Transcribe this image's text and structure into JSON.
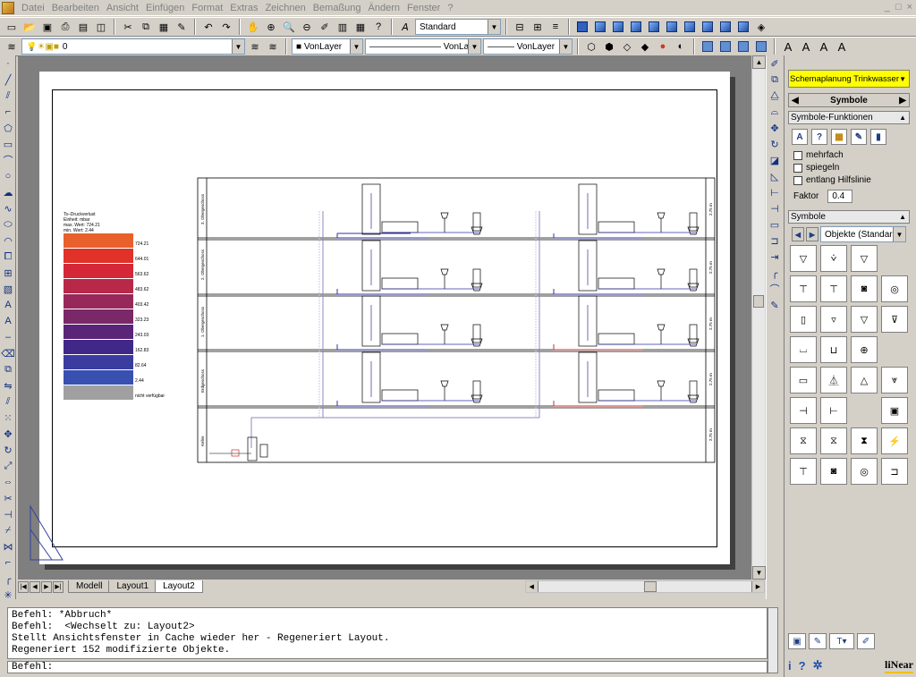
{
  "menu": [
    "Datei",
    "Bearbeiten",
    "Ansicht",
    "Einfügen",
    "Format",
    "Extras",
    "Zeichnen",
    "Bemaßung",
    "Ändern",
    "Fenster",
    "?"
  ],
  "window_controls": [
    "_",
    "□",
    "×"
  ],
  "toolbar1": {
    "text_style": "Standard"
  },
  "toolbar2": {
    "layer": "0",
    "color": "VonLayer",
    "linetype": "VonLayer",
    "lineweight": "VonLayer"
  },
  "tabs": [
    "Modell",
    "Layout1",
    "Layout2"
  ],
  "active_tab": "Layout2",
  "legend": {
    "title_lines": [
      "Ts–Druckverlust",
      "Einheit: mbar",
      "max. Wert: 724.21",
      "min. Wert: 2.44"
    ],
    "entries": [
      {
        "value": "724.21",
        "color": "#e8602c"
      },
      {
        "value": "644.01",
        "color": "#e03228"
      },
      {
        "value": "563.62",
        "color": "#d42838"
      },
      {
        "value": "483.62",
        "color": "#b82848"
      },
      {
        "value": "403.42",
        "color": "#98285a"
      },
      {
        "value": "323.23",
        "color": "#7a2868"
      },
      {
        "value": "243.03",
        "color": "#5a2478"
      },
      {
        "value": "162.83",
        "color": "#402888"
      },
      {
        "value": "82.64",
        "color": "#3a3ca0"
      },
      {
        "value": "2.44",
        "color": "#3850b0"
      },
      {
        "value": "nicht verfügbar",
        "color": "#a0a0a0"
      }
    ]
  },
  "floors": [
    "3. Obergeschoss",
    "2. Obergeschoss",
    "1. Obergeschoss",
    "Erdgeschoss",
    "Keller"
  ],
  "floor_heights": [
    "2.75 m",
    "2.75 m",
    "2.75 m",
    "2.75 m",
    "2.75 m"
  ],
  "command": {
    "log": [
      "Befehl: *Abbruch*",
      "Befehl:  <Wechselt zu: Layout2>",
      "Stellt Ansichtsfenster in Cache wieder her - Regeneriert Layout.",
      "Regeneriert 152 modifizierte Objekte."
    ],
    "prompt": "Befehl:"
  },
  "panel": {
    "dropdown": "Schemaplanung Trinkwasser",
    "symbole_header": "Symbole",
    "functions_header": "Symbole-Funktionen",
    "options": [
      "mehrfach",
      "spiegeln",
      "entlang Hilfslinie"
    ],
    "faktor_label": "Faktor",
    "faktor_value": "0.4",
    "symbols_header": "Symbole",
    "objects_select": "Objekte (Standard)",
    "logo": "liNear"
  }
}
